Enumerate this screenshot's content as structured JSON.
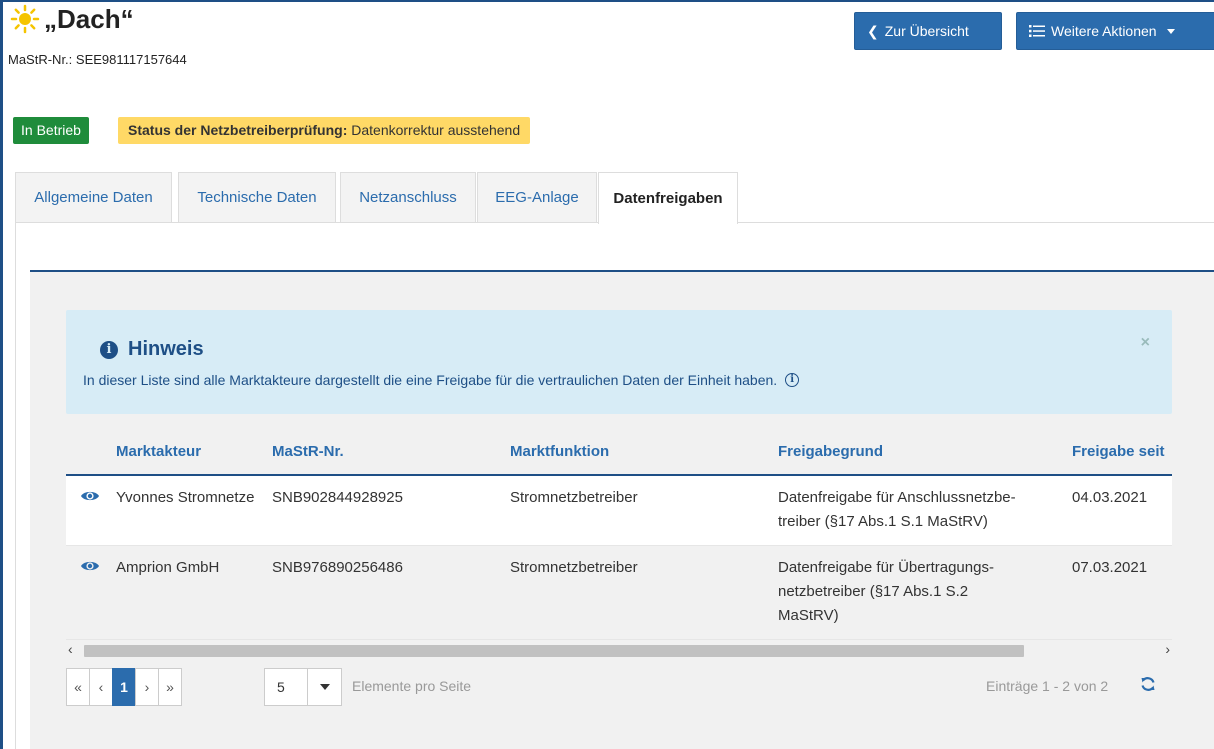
{
  "header": {
    "title": "„Dach“",
    "mastr": "MaStR-Nr.: SEE981117157644",
    "back_label": "Zur Übersicht",
    "more_label": "Weitere Aktionen"
  },
  "status": {
    "operation": "In Betrieb",
    "check_label": "Status der Netzbetreiberprüfung:",
    "check_value": "Datenkorrektur ausstehend"
  },
  "tabs": [
    {
      "label": "Allgemeine Daten"
    },
    {
      "label": "Technische Daten"
    },
    {
      "label": "Netzanschluss"
    },
    {
      "label": "EEG-Anlage"
    },
    {
      "label": "Datenfreigaben"
    }
  ],
  "hint": {
    "title": "Hinweis",
    "text": "In dieser Liste sind alle Marktakteure dargestellt die eine Freigabe für die vertraulichen Daten der Einheit haben.",
    "close": "×"
  },
  "table": {
    "headers": [
      "Marktakteur",
      "MaStR-Nr.",
      "Marktfunktion",
      "Freigabegrund",
      "Freigabe seit"
    ],
    "rows": [
      {
        "actor": "Yvonnes Stromnetze",
        "mastr": "SNB902844928925",
        "function": "Stromnetzbetreiber",
        "reason": "Datenfreigabe für Anschlussnetzbe-treiber (§17 Abs.1 S.1 MaStRV)",
        "reason_line1": "Datenfreigabe für Anschlussnetzbe-",
        "reason_line2": "treiber (§17 Abs.1 S.1 MaStRV)",
        "since": "04.03.2021"
      },
      {
        "actor": "Amprion GmbH",
        "mastr": "SNB976890256486",
        "function": "Stromnetzbetreiber",
        "reason": "Datenfreigabe für Übertragungs-netzbetreiber (§17 Abs.1 S.2 MaStRV)",
        "reason_line1": "Datenfreigabe für Übertragungs-",
        "reason_line2": "netzbetreiber (§17 Abs.1 S.2",
        "reason_line3": "MaStRV)",
        "since": "07.03.2021"
      }
    ]
  },
  "pager": {
    "first": "«",
    "prev": "‹",
    "current": "1",
    "next": "›",
    "last": "»",
    "page_size": "5",
    "per_page_label": "Elemente pro Seite",
    "entries": "Einträge 1 - 2 von 2"
  },
  "colors": {
    "primary": "#2b6cad",
    "dark_blue": "#1e4f86",
    "success": "#1f8c3b",
    "warning": "#ffd966",
    "info_bg": "#d7ecf6"
  }
}
